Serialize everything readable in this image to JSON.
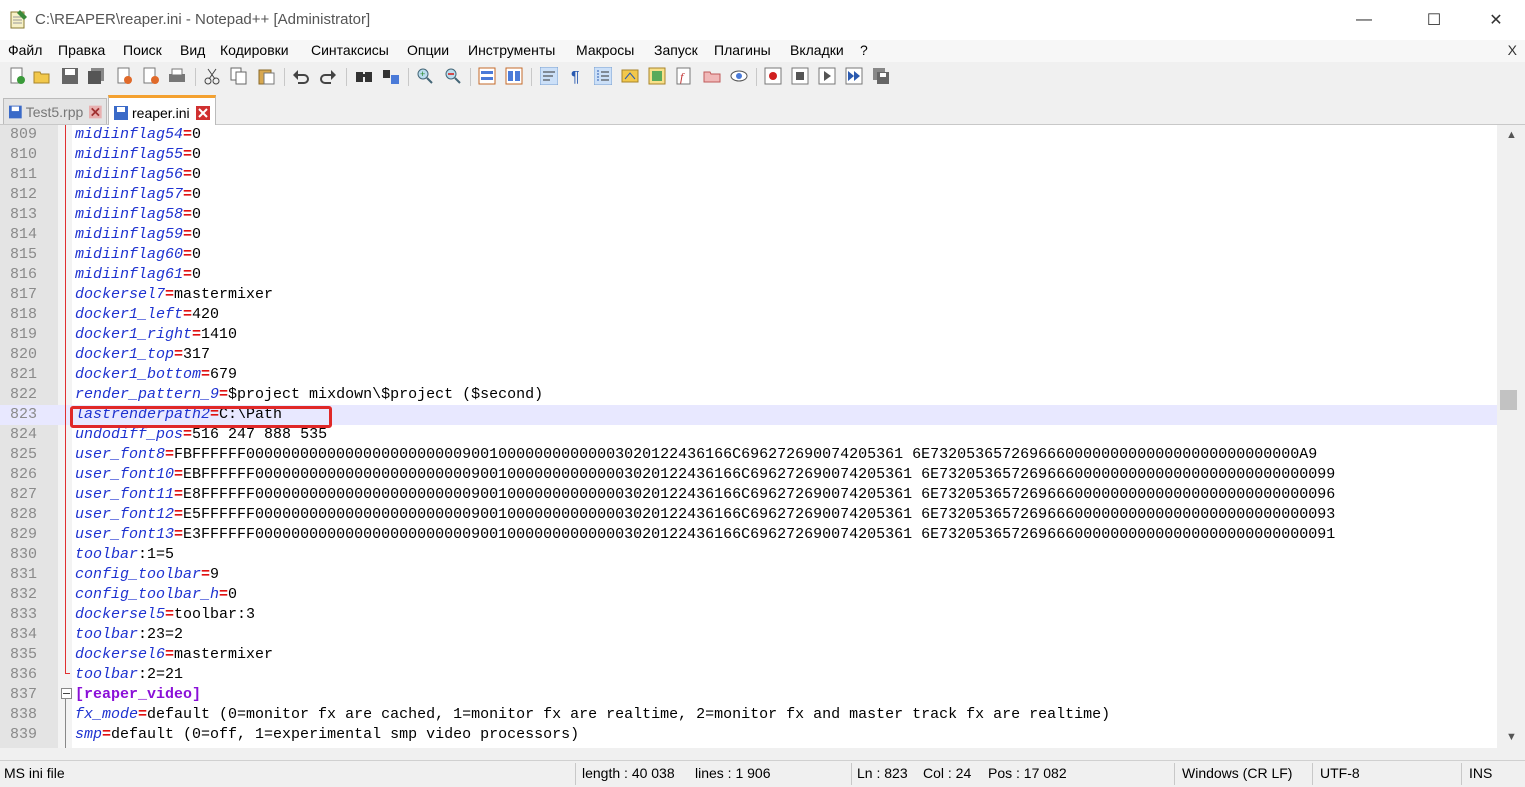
{
  "window": {
    "title": "C:\\REAPER\\reaper.ini - Notepad++ [Administrator]",
    "minimize": "—",
    "maximize": "☐",
    "close": "✕"
  },
  "menu": {
    "items": [
      "Файл",
      "Правка",
      "Поиск",
      "Вид",
      "Кодировки",
      "Синтаксисы",
      "Опции",
      "Инструменты",
      "Макросы",
      "Запуск",
      "Плагины",
      "Вкладки",
      "?"
    ],
    "close": "X"
  },
  "tabs": [
    {
      "label": "Test5.rpp",
      "active": false
    },
    {
      "label": "reaper.ini",
      "active": true
    }
  ],
  "editor": {
    "current_line": 823,
    "highlighted_line": 823,
    "lines": [
      {
        "n": "809",
        "key": "midiinflag54",
        "val": "0"
      },
      {
        "n": "810",
        "key": "midiinflag55",
        "val": "0"
      },
      {
        "n": "811",
        "key": "midiinflag56",
        "val": "0"
      },
      {
        "n": "812",
        "key": "midiinflag57",
        "val": "0"
      },
      {
        "n": "813",
        "key": "midiinflag58",
        "val": "0"
      },
      {
        "n": "814",
        "key": "midiinflag59",
        "val": "0"
      },
      {
        "n": "815",
        "key": "midiinflag60",
        "val": "0"
      },
      {
        "n": "816",
        "key": "midiinflag61",
        "val": "0"
      },
      {
        "n": "817",
        "key": "dockersel7",
        "val": "mastermixer"
      },
      {
        "n": "818",
        "key": "docker1_left",
        "val": "420"
      },
      {
        "n": "819",
        "key": "docker1_right",
        "val": "1410"
      },
      {
        "n": "820",
        "key": "docker1_top",
        "val": "317"
      },
      {
        "n": "821",
        "key": "docker1_bottom",
        "val": "679"
      },
      {
        "n": "822",
        "key": "render_pattern_9",
        "val": "$project mixdown\\$project ($second)"
      },
      {
        "n": "823",
        "key": "lastrenderpath2",
        "val": "C:\\Path"
      },
      {
        "n": "824",
        "key": "undodiff_pos",
        "val": "516 247 888 535"
      },
      {
        "n": "825",
        "key": "user_font8",
        "val": "FBFFFFFF000000000000000000000000900100000000000003020122436166C696272690074205361 6E73205365726966600000000000000000000000000A9"
      },
      {
        "n": "826",
        "key": "user_font10",
        "val": "EBFFFFFF000000000000000000000000900100000000000003020122436166C696272690074205361 6E73205365726966600000000000000000000000000099"
      },
      {
        "n": "827",
        "key": "user_font11",
        "val": "E8FFFFFF000000000000000000000000900100000000000003020122436166C696272690074205361 6E73205365726966600000000000000000000000000096"
      },
      {
        "n": "828",
        "key": "user_font12",
        "val": "E5FFFFFF000000000000000000000000900100000000000003020122436166C696272690074205361 6E73205365726966600000000000000000000000000093"
      },
      {
        "n": "829",
        "key": "user_font13",
        "val": "E3FFFFFF000000000000000000000000900100000000000003020122436166C696272690074205361 6E73205365726966600000000000000000000000000091"
      },
      {
        "n": "830",
        "key": "toolbar",
        "val": ":1=5",
        "plain": true
      },
      {
        "n": "831",
        "key": "config_toolbar",
        "val": "9"
      },
      {
        "n": "832",
        "key": "config_toolbar_h",
        "val": "0"
      },
      {
        "n": "833",
        "key": "dockersel5",
        "val": "toolbar:3"
      },
      {
        "n": "834",
        "key": "toolbar",
        "val": ":23=2",
        "plain": true
      },
      {
        "n": "835",
        "key": "dockersel6",
        "val": "mastermixer"
      },
      {
        "n": "836",
        "key": "toolbar",
        "val": ":2=21",
        "plain": true
      },
      {
        "n": "837",
        "section": "[reaper_video]"
      },
      {
        "n": "838",
        "key": "fx_mode",
        "val": "default (0=monitor fx are cached, 1=monitor fx are realtime, 2=monitor fx and master track fx are realtime)"
      },
      {
        "n": "839",
        "key": "smp",
        "val": "default (0=off, 1=experimental smp video processors)"
      }
    ]
  },
  "status": {
    "filetype": "MS ini file",
    "length": "length : 40 038",
    "lines": "lines : 1 906",
    "ln": "Ln : 823",
    "col": "Col : 24",
    "pos": "Pos : 17 082",
    "eol": "Windows (CR LF)",
    "encoding": "UTF-8",
    "mode": "INS"
  },
  "colors": {
    "key": "#1e32d0",
    "equals": "#e01010",
    "section": "#8a10d8",
    "current_line": "#e8e8ff",
    "highlight_box": "#e02828",
    "active_tab_accent": "#f4a130"
  }
}
